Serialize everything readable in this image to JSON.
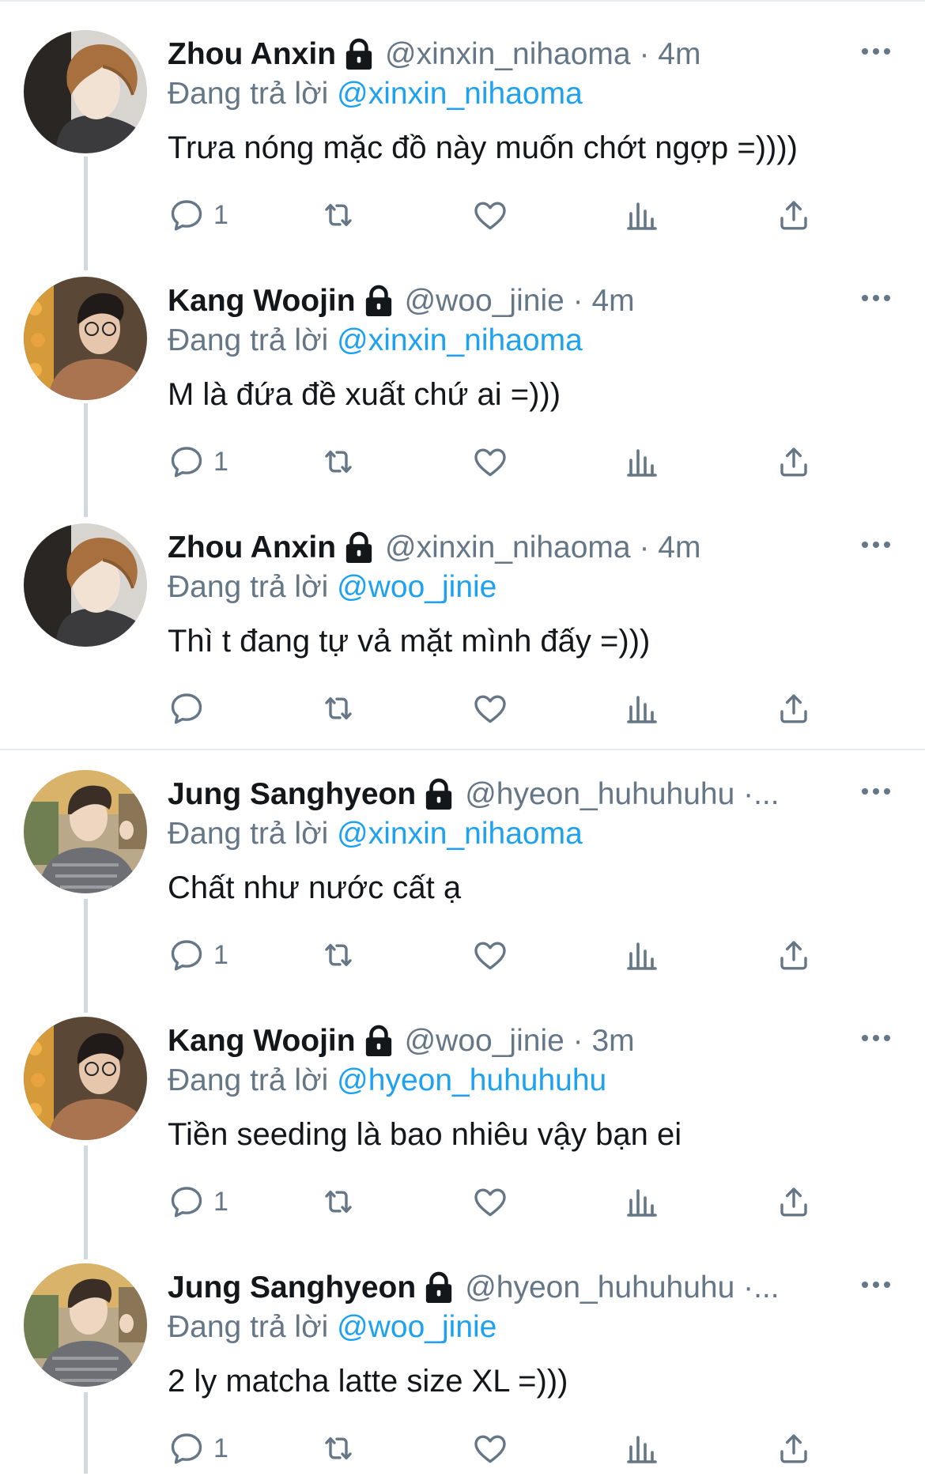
{
  "reply_prefix": "Đang trả lời",
  "colors": {
    "text": "#14171a",
    "muted": "#657786",
    "link": "#1da1f2",
    "divider": "#e6ecf0",
    "thread_line": "#cfd9de"
  },
  "icons": {
    "more": "more-icon",
    "lock": "lock-icon",
    "reply": "reply-icon",
    "retweet": "retweet-icon",
    "like": "heart-icon",
    "views": "analytics-icon",
    "share": "share-icon"
  },
  "tweets": [
    {
      "name": "Zhou Anxin",
      "handle_time": "@xinxin_nihaoma · 4m",
      "mention": "@xinxin_nihaoma",
      "text": "Trưa nóng mặc đồ này muốn chớt ngợp =))))",
      "reply_count": "1"
    },
    {
      "name": "Kang Woojin",
      "handle_time": "@woo_jinie · 4m",
      "mention": "@xinxin_nihaoma",
      "text": "M là đứa đề xuất chứ ai =)))",
      "reply_count": "1"
    },
    {
      "name": "Zhou Anxin",
      "handle_time": "@xinxin_nihaoma · 4m",
      "mention": "@woo_jinie",
      "text": "Thì t đang tự vả mặt mình đấy =)))",
      "reply_count": ""
    },
    {
      "name": "Jung Sanghyeon",
      "handle_time": "@hyeon_huhuhuhu ·...",
      "mention": "@xinxin_nihaoma",
      "text": "Chất như nước cất ạ",
      "reply_count": "1"
    },
    {
      "name": "Kang Woojin",
      "handle_time": "@woo_jinie · 3m",
      "mention": "@hyeon_huhuhuhu",
      "text": "Tiền seeding là bao nhiêu vậy bạn ei",
      "reply_count": "1"
    },
    {
      "name": "Jung Sanghyeon",
      "handle_time": "@hyeon_huhuhuhu ·...",
      "mention": "@woo_jinie",
      "text": "2 ly matcha latte size XL =)))",
      "reply_count": "1"
    }
  ]
}
